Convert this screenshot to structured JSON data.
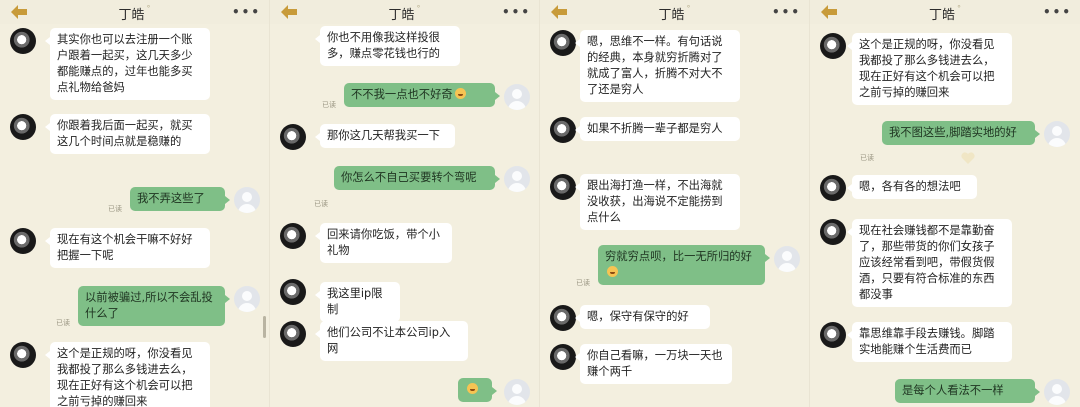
{
  "header": {
    "title": "丁皓",
    "status_dot": "°",
    "more": "•••"
  },
  "read_label": "已读",
  "colors": {
    "background": "#f3efdf",
    "incoming_bubble": "#ffffff",
    "outgoing_bubble": "#7fbf87",
    "back_arrow": "#c89b3a"
  },
  "panels": [
    {
      "messages": [
        {
          "side": "in",
          "text": "其实你也可以去注册一个账户跟着一起买，这几天多少都能赚点的，过年也能多买点礼物给爸妈"
        },
        {
          "side": "in",
          "text": "你跟着我后面一起买，就买这几个时间点就是稳赚的"
        },
        {
          "side": "out",
          "text": "我不弄这些了",
          "read": true
        },
        {
          "side": "in",
          "text": "现在有这个机会干嘛不好好把握一下呢"
        },
        {
          "side": "out",
          "text": "以前被骗过,所以不会乱投什么了",
          "read": true
        },
        {
          "side": "in",
          "text": "这个是正规的呀，你没看见我都投了那么多钱进去么，现在正好有这个机会可以把之前亏掉的赚回来"
        }
      ]
    },
    {
      "messages": [
        {
          "side": "in",
          "text": "你也不用像我这样投很多，赚点零花钱也行的"
        },
        {
          "side": "out",
          "text": "不不我一点也不好奇",
          "emoji": "scared-face-icon",
          "read": true
        },
        {
          "side": "in",
          "text": "那你这几天帮我买一下"
        },
        {
          "side": "out",
          "text": "你怎么不自己买要转个弯呢",
          "read": true
        },
        {
          "side": "in",
          "text": "回来请你吃饭，带个小礼物"
        },
        {
          "side": "in",
          "text": "我这里ip限制"
        },
        {
          "side": "in",
          "text": "他们公司不让本公司ip入网"
        },
        {
          "side": "out",
          "text": "",
          "emoji": "laughing-tears-icon"
        }
      ]
    },
    {
      "messages": [
        {
          "side": "in",
          "text": "嗯，思维不一样。有句话说的经典，本身就穷折腾对了就成了富人，折腾不对大不了还是穷人"
        },
        {
          "side": "in",
          "text": "如果不折腾一辈子都是穷人"
        },
        {
          "side": "in",
          "text": "跟出海打渔一样，不出海就没收获，出海说不定能捞到点什么"
        },
        {
          "side": "out",
          "text": "穷就穷点呗，比一无所归的好",
          "emoji": "laughing-tears-icon",
          "read": true
        },
        {
          "side": "in",
          "text": "嗯，保守有保守的好"
        },
        {
          "side": "in",
          "text": "你自己看嘛，一万块一天也赚个两千"
        }
      ]
    },
    {
      "messages": [
        {
          "side": "in",
          "text": "这个是正规的呀，你没看见我都投了那么多钱进去么，现在正好有这个机会可以把之前亏掉的赚回来"
        },
        {
          "side": "out",
          "text": "我不图这些,脚踏实地的好",
          "read": true
        },
        {
          "side": "in",
          "text": "嗯，各有各的想法吧"
        },
        {
          "side": "in",
          "text": "现在社会赚钱都不是靠勤奋了，那些带货的你们女孩子应该经常看到吧，带假货假酒，只要有符合标准的东西都没事"
        },
        {
          "side": "in",
          "text": "靠思维靠手段去赚钱。脚踏实地能赚个生活费而已"
        },
        {
          "side": "out",
          "text": "是每个人看法不一样"
        }
      ]
    }
  ]
}
